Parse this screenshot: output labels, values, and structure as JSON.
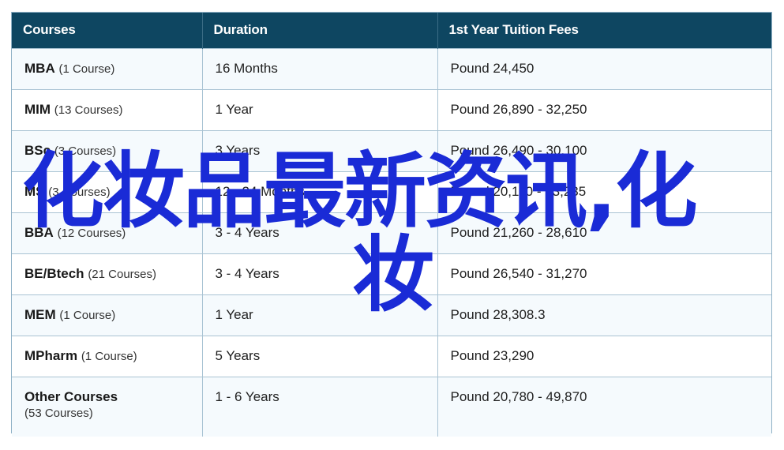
{
  "table": {
    "headers": [
      "Courses",
      "Duration",
      "1st Year Tuition Fees"
    ],
    "rows": [
      {
        "name": "MBA",
        "count": "(1 Course)",
        "duration": "16 Months",
        "fees": "Pound 24,450"
      },
      {
        "name": "MIM",
        "count": "(13 Courses)",
        "duration": "1 Year",
        "fees": "Pound 26,890 - 32,250"
      },
      {
        "name": "BSc",
        "count": "(3 Courses)",
        "duration": "3 Years",
        "fees": "Pound 26,490 - 30,100"
      },
      {
        "name": "MS",
        "count": "(3 Courses)",
        "duration": "12 - 24 Months",
        "fees": "Pound 20,110 - 33,235"
      },
      {
        "name": "BBA",
        "count": "(12 Courses)",
        "duration": "3 - 4 Years",
        "fees": "Pound 21,260 - 28,610"
      },
      {
        "name": "BE/Btech",
        "count": "(21 Courses)",
        "duration": "3 - 4 Years",
        "fees": "Pound 26,540 - 31,270"
      },
      {
        "name": "MEM",
        "count": "(1 Course)",
        "duration": "1 Year",
        "fees": "Pound 28,308.3"
      },
      {
        "name": "MPharm",
        "count": "(1 Course)",
        "duration": "5 Years",
        "fees": "Pound 23,290"
      },
      {
        "name": "Other Courses",
        "count": "(53 Courses)",
        "duration": "1 - 6 Years",
        "fees": "Pound 20,780 - 49,870"
      }
    ]
  },
  "overlay": {
    "line1": "化妆品最新资讯,化",
    "line2": "妆",
    "color": "#1a2bd6"
  },
  "colors": {
    "header_bg": "#0e4661",
    "header_text": "#ffffff",
    "border": "#a9c3d3",
    "row_alt": "#f5fafd"
  }
}
